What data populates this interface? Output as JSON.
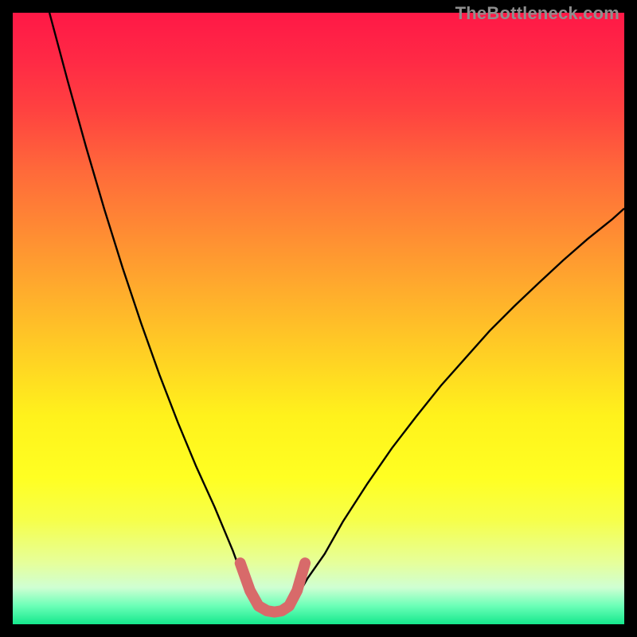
{
  "watermark": "TheBottleneck.com",
  "chart_data": {
    "type": "line",
    "title": "",
    "xlabel": "",
    "ylabel": "",
    "xlim": [
      0,
      1
    ],
    "ylim": [
      0,
      1
    ],
    "series": [
      {
        "name": "left-curve",
        "x": [
          0.06,
          0.09,
          0.12,
          0.15,
          0.18,
          0.21,
          0.24,
          0.27,
          0.3,
          0.33,
          0.36,
          0.375,
          0.387
        ],
        "y": [
          1.0,
          0.888,
          0.78,
          0.678,
          0.582,
          0.492,
          0.408,
          0.33,
          0.258,
          0.192,
          0.12,
          0.079,
          0.048
        ]
      },
      {
        "name": "right-curve",
        "x": [
          0.465,
          0.482,
          0.51,
          0.54,
          0.58,
          0.62,
          0.66,
          0.7,
          0.74,
          0.78,
          0.82,
          0.86,
          0.9,
          0.94,
          0.98,
          1.0
        ],
        "y": [
          0.045,
          0.075,
          0.115,
          0.168,
          0.23,
          0.288,
          0.34,
          0.39,
          0.435,
          0.48,
          0.52,
          0.558,
          0.595,
          0.63,
          0.662,
          0.68
        ]
      },
      {
        "name": "highlight-band",
        "x": [
          0.372,
          0.388,
          0.402,
          0.416,
          0.428,
          0.44,
          0.452,
          0.465,
          0.478
        ],
        "y": [
          0.1,
          0.055,
          0.03,
          0.022,
          0.02,
          0.022,
          0.03,
          0.055,
          0.1
        ]
      }
    ],
    "highlight_color": "#d86a6a",
    "curve_color": "#000000"
  }
}
